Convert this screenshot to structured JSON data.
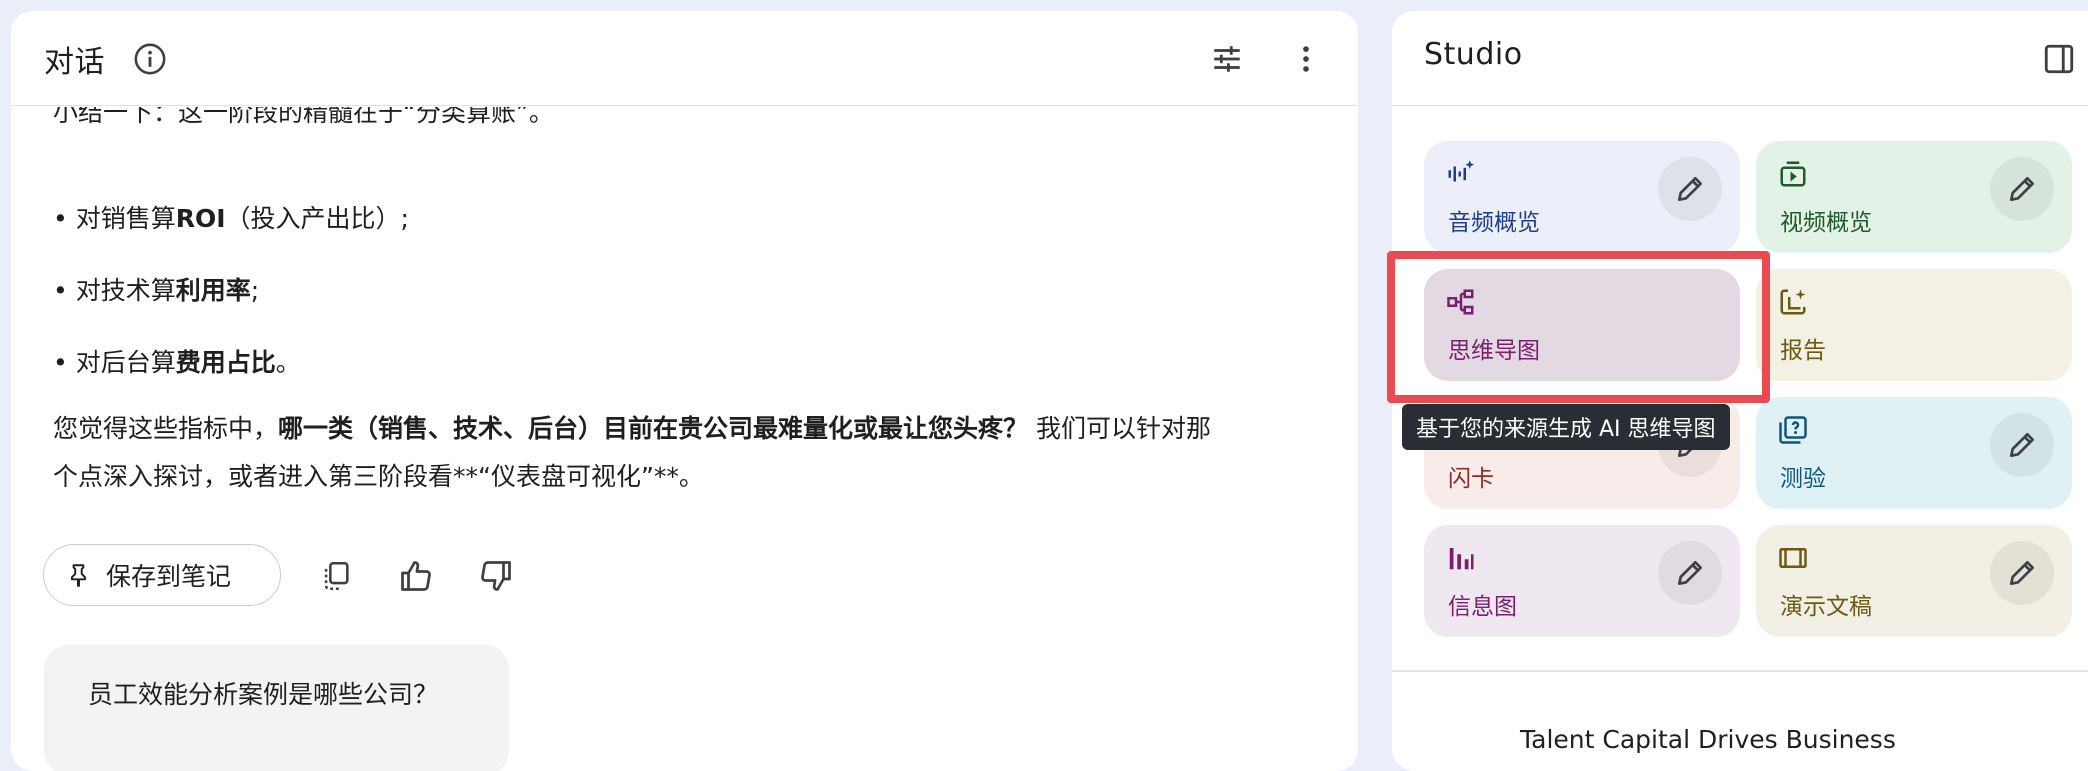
{
  "chat": {
    "title": "对话",
    "clipped_line": "小结一下：这一阶段的精髓在于“分类算账”。",
    "bullets": [
      {
        "pre": "• 对销售算",
        "bold": "ROI",
        "post": "（投入产出比）;"
      },
      {
        "pre": "• 对技术算",
        "bold": "利用率",
        "post": ";"
      },
      {
        "pre": "• 对后台算",
        "bold": "费用占比",
        "post": "。"
      }
    ],
    "question_pre": "您觉得这些指标中，",
    "question_bold": "哪一类（销售、技术、后台）目前在贵公司最难量化或最让您头疼？",
    "question_post": " 我们可以针对那个点深入探讨，或者进入第三阶段看**“仪表盘可视化”**。",
    "save_label": "保存到笔记",
    "user_message": "员工效能分析案例是哪些公司？"
  },
  "studio": {
    "title": "Studio",
    "tiles": [
      {
        "label": "音频概览",
        "icon": "audio-waveform-icon",
        "bg": "#eceff9",
        "fg": "#1f3e8a"
      },
      {
        "label": "视频概览",
        "icon": "video-play-icon",
        "bg": "#e3f2e6",
        "fg": "#1e5a2a"
      },
      {
        "label": "思维导图",
        "icon": "mind-map-icon",
        "bg": "#e2d9e3",
        "fg": "#7a1f6e"
      },
      {
        "label": "报告",
        "icon": "report-icon",
        "bg": "#f3f1e4",
        "fg": "#6a5a13"
      },
      {
        "label": "闪卡",
        "icon": "flashcard-icon",
        "bg": "#f8ecea",
        "fg": "#8a2c22"
      },
      {
        "label": "测验",
        "icon": "quiz-icon",
        "bg": "#e0f1f6",
        "fg": "#10567a"
      },
      {
        "label": "信息图",
        "icon": "infographic-icon",
        "bg": "#f0e8f0",
        "fg": "#7a1f6e"
      },
      {
        "label": "演示文稿",
        "icon": "slides-icon",
        "bg": "#f2f0e4",
        "fg": "#6a5a13"
      }
    ],
    "tooltip": "基于您的来源生成 AI 思维导图",
    "bottom_text": "Talent Capital Drives Business"
  },
  "colors": {
    "highlight": "#ea4a50",
    "background": "#ebeef8"
  }
}
